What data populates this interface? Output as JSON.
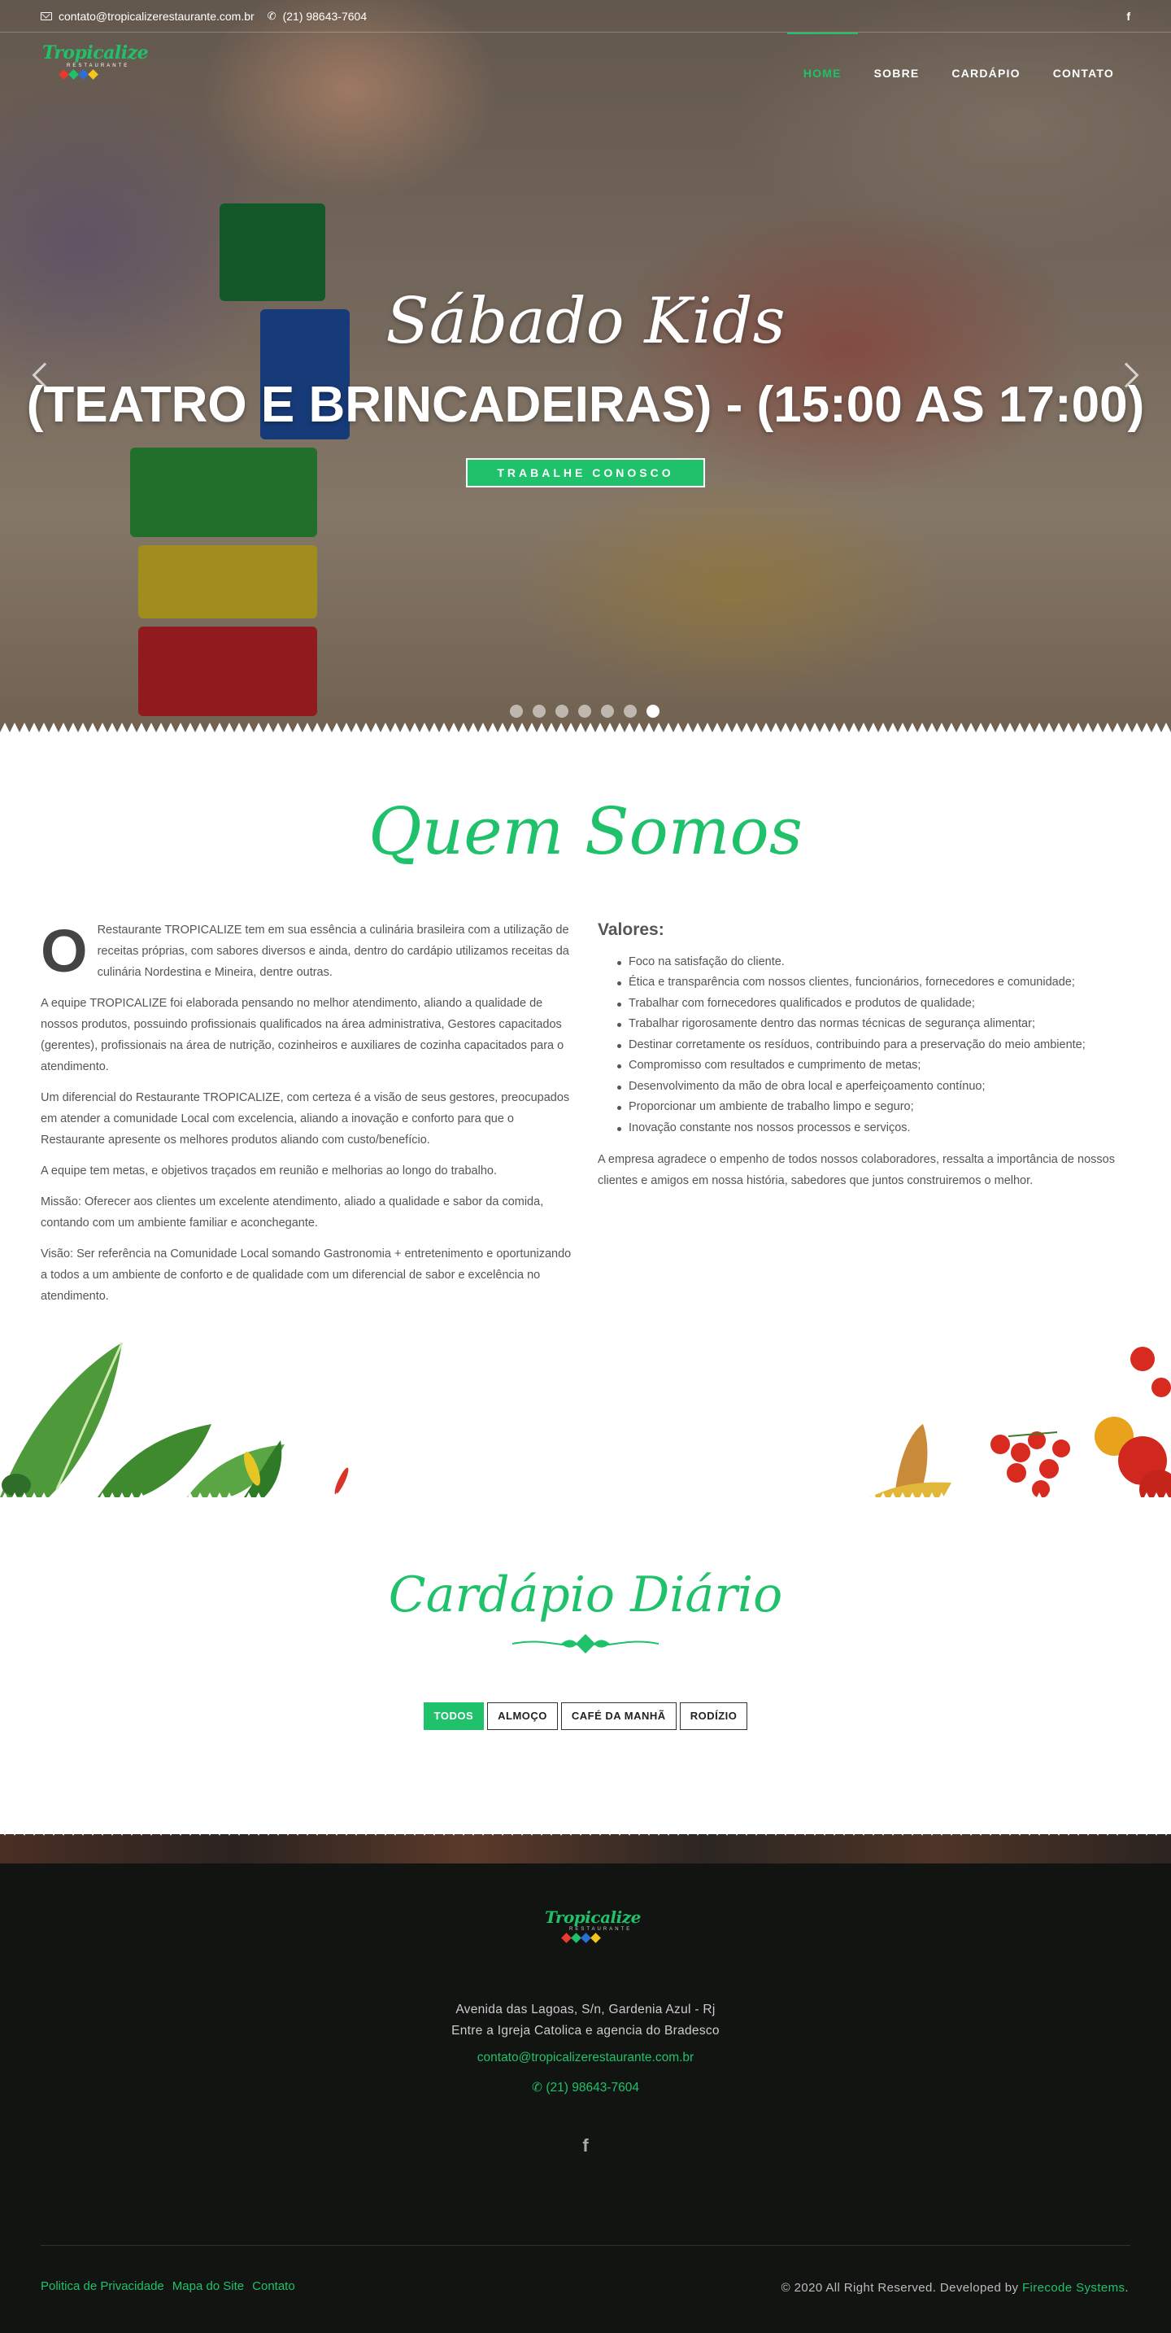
{
  "topbar": {
    "email": "contato@tropicalizerestaurante.com.br",
    "phone": "(21) 98643-7604",
    "facebook_icon": "f"
  },
  "logo": {
    "name": "Tropicalize",
    "sub": "RESTAURANTE"
  },
  "nav": {
    "items": [
      {
        "label": "HOME",
        "active": true
      },
      {
        "label": "SOBRE",
        "active": false
      },
      {
        "label": "CARDÁPIO",
        "active": false
      },
      {
        "label": "CONTATO",
        "active": false
      }
    ]
  },
  "hero": {
    "script_title": "Sábado Kids",
    "title": "(TEATRO E BRINCADEIRAS) - (15:00 AS 17:00)",
    "button": "TRABALHE CONOSCO",
    "slide_count": 7,
    "active_slide": 7
  },
  "about": {
    "title": "Quem Somos",
    "dropcap": "O",
    "paragraphs": [
      "Restaurante TROPICALIZE tem em sua essência a culinária brasileira com a utilização de receitas próprias, com sabores diversos e ainda, dentro do cardápio utilizamos receitas da culinária Nordestina e Mineira, dentre outras.",
      "A equipe TROPICALIZE foi elaborada pensando no melhor atendimento, aliando a qualidade de nossos produtos, possuindo profissionais qualificados na área administrativa, Gestores capacitados (gerentes), profissionais na área de nutrição, cozinheiros e auxiliares de cozinha capacitados para o atendimento.",
      "Um diferencial do Restaurante TROPICALIZE, com certeza é a visão de seus gestores, preocupados em atender a comunidade Local com excelencia, aliando a inovação e conforto para que o Restaurante apresente os melhores produtos aliando com custo/benefício.",
      "A equipe tem metas, e objetivos traçados em reunião e melhorias ao longo do trabalho.",
      "Missão: Oferecer aos clientes um excelente atendimento, aliado a qualidade e sabor da comida, contando com um ambiente familiar e aconchegante.",
      "Visão: Ser referência na Comunidade Local somando Gastronomia + entretenimento e oportunizando a todos a um ambiente de conforto e de qualidade com um diferencial de sabor e excelência no atendimento."
    ],
    "values_title": "Valores:",
    "values": [
      "Foco na satisfação do cliente.",
      "Ética e transparência com nossos clientes, funcionários, fornecedores e comunidade;",
      "Trabalhar com fornecedores qualificados e produtos de qualidade;",
      "Trabalhar rigorosamente dentro das normas técnicas de segurança alimentar;",
      "Destinar corretamente os resíduos, contribuindo para a preservação do meio ambiente;",
      "Compromisso com resultados e cumprimento de metas;",
      "Desenvolvimento da mão de obra local e aperfeiçoamento contínuo;",
      "Proporcionar um ambiente de trabalho limpo e seguro;",
      "Inovação constante nos nossos processos e serviços."
    ],
    "closing": "A empresa agradece o empenho de todos nossos colaboradores, ressalta a importância de nossos clientes e amigos em nossa história, sabedores que juntos construiremos o melhor."
  },
  "menu": {
    "title": "Cardápio Diário",
    "filters": [
      {
        "label": "TODOS",
        "active": true
      },
      {
        "label": "ALMOÇO",
        "active": false
      },
      {
        "label": "CAFÉ DA MANHÃ",
        "active": false
      },
      {
        "label": "RODÍZIO",
        "active": false
      }
    ]
  },
  "footer": {
    "address_line1": "Avenida das Lagoas, S/n, Gardenia Azul - Rj",
    "address_line2": "Entre a Igreja Catolica e agencia do Bradesco",
    "email": "contato@tropicalizerestaurante.com.br",
    "phone": "(21) 98643-7604",
    "facebook_icon": "f",
    "links": [
      "Politica de Privacidade",
      "Mapa do Site",
      "Contato"
    ],
    "copyright": "© 2020 All Right Reserved. Developed by ",
    "developer": "Firecode Systems",
    "copyright_end": "."
  },
  "colors": {
    "accent": "#1fc16a",
    "footer_bg": "#121412",
    "text": "#555555"
  }
}
